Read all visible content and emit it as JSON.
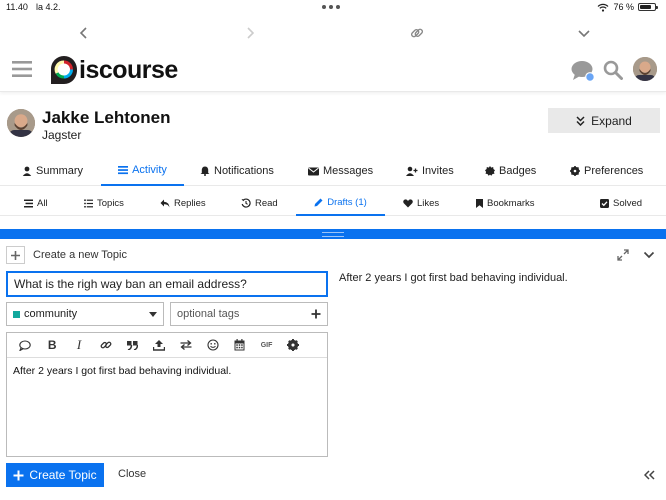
{
  "status_bar": {
    "time": "11.40",
    "date": "la 4.2.",
    "battery": "76 %",
    "battery_level": 0.76
  },
  "header": {
    "logo_text": "iscourse"
  },
  "user": {
    "name": "Jakke Lehtonen",
    "title": "Jagster",
    "expand_label": "Expand"
  },
  "primary_nav": [
    {
      "label": "Summary",
      "icon": "user-icon"
    },
    {
      "label": "Activity",
      "icon": "list-icon",
      "active": true
    },
    {
      "label": "Notifications",
      "icon": "bell-icon"
    },
    {
      "label": "Messages",
      "icon": "envelope-icon"
    },
    {
      "label": "Invites",
      "icon": "user-plus-icon"
    },
    {
      "label": "Badges",
      "icon": "certificate-icon"
    },
    {
      "label": "Preferences",
      "icon": "gear-icon"
    }
  ],
  "secondary_nav": [
    {
      "label": "All",
      "icon": "stream-icon"
    },
    {
      "label": "Topics",
      "icon": "list-ul-icon"
    },
    {
      "label": "Replies",
      "icon": "reply-icon"
    },
    {
      "label": "Read",
      "icon": "history-icon"
    },
    {
      "label": "Drafts (1)",
      "icon": "pencil-icon",
      "active": true
    },
    {
      "label": "Likes",
      "icon": "heart-icon"
    },
    {
      "label": "Bookmarks",
      "icon": "bookmark-icon"
    },
    {
      "label": "Solved",
      "icon": "check-square-icon"
    }
  ],
  "composer": {
    "action_label": "Create a new Topic",
    "title_value": "What is the righ way ban an email address?",
    "category": "community",
    "category_color": "#12a89d",
    "tags_placeholder": "optional tags",
    "body_text": "After 2 years I got first bad behaving individual.",
    "preview_text": "After 2 years I got first bad behaving individual.",
    "gif_label": "GIF",
    "create_label": "Create Topic",
    "close_label": "Close"
  },
  "colors": {
    "accent": "#0a72ef"
  }
}
